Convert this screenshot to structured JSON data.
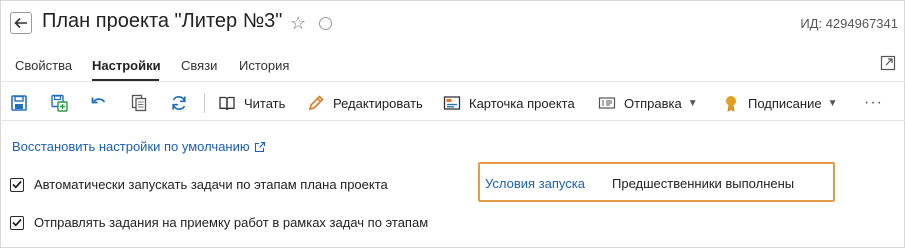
{
  "header": {
    "title": "План проекта \"Литер №3\"",
    "id_label": "ИД: 4294967341"
  },
  "tabs": [
    {
      "label": "Свойства",
      "active": false
    },
    {
      "label": "Настройки",
      "active": true
    },
    {
      "label": "Связи",
      "active": false
    },
    {
      "label": "История",
      "active": false
    }
  ],
  "toolbar": {
    "icons": [
      "save-icon",
      "save-as-icon",
      "undo-icon",
      "copy-icon",
      "refresh-icon"
    ],
    "read_label": "Читать",
    "edit_label": "Редактировать",
    "card_label": "Карточка проекта",
    "send_label": "Отправка",
    "sign_label": "Подписание",
    "more_label": "···"
  },
  "content": {
    "restore_link": "Восстановить настройки по умолчанию",
    "auto_start_label": "Автоматически запускать задачи по этапам плана проекта",
    "auto_start_checked": true,
    "send_tasks_label": "Отправлять задания на приемку работ в рамках задач по этапам",
    "send_tasks_checked": true,
    "launch_conditions_label": "Условия запуска",
    "launch_conditions_value": "Предшественники выполнены"
  },
  "colors": {
    "link": "#1a5fb4",
    "highlight_border": "#e59a47",
    "icon_blue": "#1f6fbf",
    "icon_green": "#2e9a4a",
    "icon_orange": "#e07a22",
    "icon_gold": "#e0a020"
  }
}
